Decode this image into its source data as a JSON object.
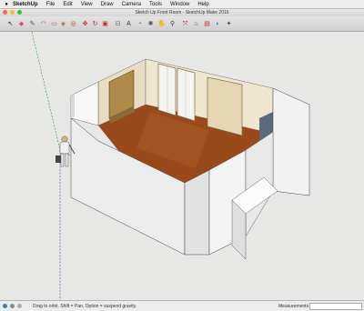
{
  "menu": {
    "app": "SketchUp",
    "items": [
      "File",
      "Edit",
      "View",
      "Draw",
      "Camera",
      "Tools",
      "Window",
      "Help"
    ]
  },
  "window": {
    "title": "Sketch Up Front Room - SketchUp Make 2016"
  },
  "toolbar": {
    "tools": [
      {
        "name": "select-tool-icon",
        "glyph": "↖",
        "color": "#222222"
      },
      {
        "name": "eraser-tool-icon",
        "glyph": "◆",
        "color": "#d9547a"
      },
      {
        "name": "pencil-tool-icon",
        "glyph": "✎",
        "color": "#5a4a2a"
      },
      {
        "name": "arc-tool-icon",
        "glyph": "◠",
        "color": "#c23b2c"
      },
      {
        "name": "shapes-tool-icon",
        "glyph": "▭",
        "color": "#c23b2c"
      },
      {
        "name": "push-pull-tool-icon",
        "glyph": "◈",
        "color": "#a0682c"
      },
      {
        "name": "offset-tool-icon",
        "glyph": "◎",
        "color": "#b63a2a"
      },
      {
        "name": "move-tool-icon",
        "glyph": "✥",
        "color": "#c02a2a"
      },
      {
        "name": "rotate-tool-icon",
        "glyph": "↻",
        "color": "#c02a2a"
      },
      {
        "name": "scale-tool-icon",
        "glyph": "▣",
        "color": "#c02a2a"
      },
      {
        "name": "tape-measure-tool-icon",
        "glyph": "⊟",
        "color": "#777777"
      },
      {
        "name": "text-tool-icon",
        "glyph": "A",
        "color": "#333333"
      },
      {
        "name": "paint-bucket-tool-icon",
        "glyph": "◔",
        "color": "#2a6fb0"
      },
      {
        "name": "orbit-tool-icon",
        "glyph": "✺",
        "color": "#555555"
      },
      {
        "name": "pan-tool-icon",
        "glyph": "✋",
        "color": "#8a6a4a"
      },
      {
        "name": "zoom-tool-icon",
        "glyph": "⚲",
        "color": "#333333"
      },
      {
        "name": "zoom-extents-tool-icon",
        "glyph": "⤧",
        "color": "#c02a2a"
      },
      {
        "name": "warehouse-tool-icon",
        "glyph": "⌂",
        "color": "#c02a2a"
      },
      {
        "name": "extension-warehouse-icon",
        "glyph": "▤",
        "color": "#c02a2a"
      },
      {
        "name": "layout-icon",
        "glyph": "◐",
        "color": "#3a7ac0"
      },
      {
        "name": "extension-manager-icon",
        "glyph": "✦",
        "color": "#4a4a4a"
      }
    ]
  },
  "status": {
    "hint": "Drag to orbit. Shift = Pan, Option = suspend gravity.",
    "measurements_label": "Measurements"
  },
  "colors": {
    "sky": "#e7e7e5",
    "floor": "#9a4a1a",
    "wall_top": "#f5f5f5",
    "wall_side": "#dcdcdc"
  }
}
